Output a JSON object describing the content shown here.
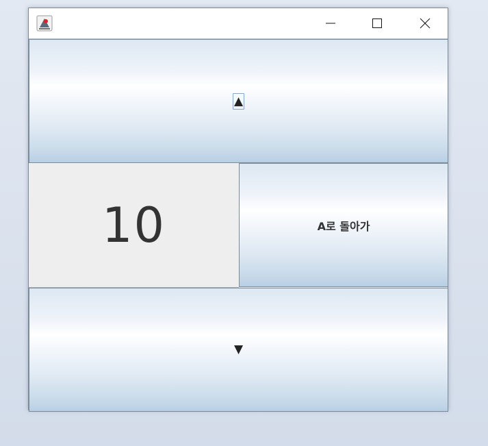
{
  "window": {
    "title": "",
    "controls": {
      "minimize_icon": "minimize-icon",
      "maximize_icon": "maximize-icon",
      "close_icon": "close-icon"
    }
  },
  "buttons": {
    "up_label": "▲",
    "down_label": "▼",
    "back_label": "A로 돌아가"
  },
  "counter": {
    "value": "10"
  },
  "colors": {
    "button_gradient_top": "#dde8f3",
    "button_gradient_mid": "#ffffff",
    "button_gradient_bottom": "#b8cfe4",
    "panel_bg": "#eeeeee",
    "text": "#333333"
  }
}
